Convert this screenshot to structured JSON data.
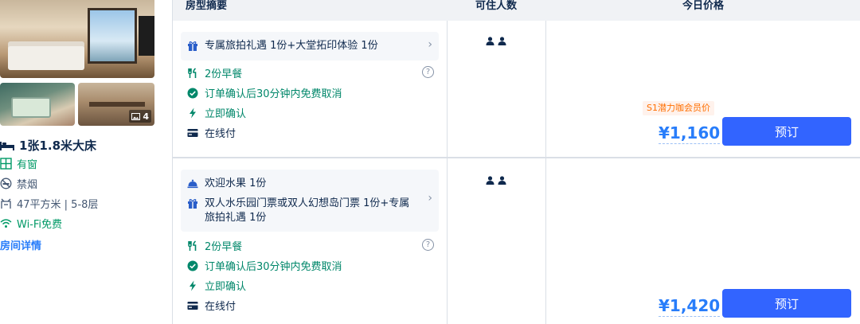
{
  "room": {
    "photo_count": "4",
    "title": "1张1.8米大床",
    "features": [
      {
        "icon": "window-icon",
        "text": "有窗"
      },
      {
        "icon": "no-smoking-icon",
        "text": "禁烟"
      },
      {
        "icon": "area-icon",
        "text": "47平方米 | 5-8层"
      },
      {
        "icon": "wifi-icon",
        "text": "Wi-Fi免费"
      }
    ],
    "detail_link": "房间详情"
  },
  "table_header": {
    "summary": "房型摘要",
    "occupancy": "可住人数",
    "price": "今日价格"
  },
  "offers": [
    {
      "perks": [
        "专属旅拍礼遇 1份+大堂拓印体验 1份"
      ],
      "breakfast": "2份早餐",
      "cancel": "订单确认后30分钟内免费取消",
      "confirm": "立即确认",
      "payment": "在线付",
      "member_tag": "S1潜力咖会员价",
      "price": "¥1,160",
      "book": "预订"
    },
    {
      "perks": [
        "欢迎水果 1份",
        "双人水乐园门票或双人幻想岛门票 1份+专属",
        "旅拍礼遇 1份"
      ],
      "breakfast": "2份早餐",
      "cancel": "订单确认后30分钟内免费取消",
      "confirm": "立即确认",
      "payment": "在线付",
      "price": "¥1,420",
      "book": "预订"
    }
  ],
  "colors": {
    "accent": "#287dfa",
    "button": "#3264ff",
    "green": "#00876a",
    "member": "#ff6f00",
    "text": "#0f294d"
  }
}
